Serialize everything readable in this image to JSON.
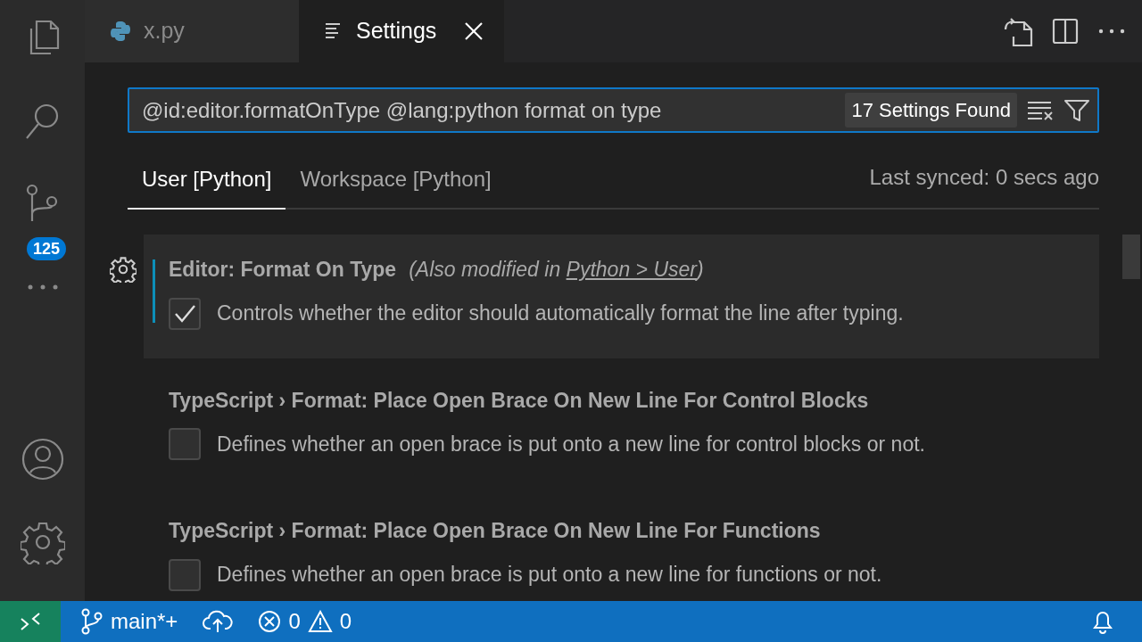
{
  "activity_bar": {
    "source_control_badge": "125"
  },
  "tabs": [
    {
      "label": "x.py",
      "kind": "python",
      "selected": false
    },
    {
      "label": "Settings",
      "kind": "settings",
      "selected": true
    }
  ],
  "search": {
    "value": "@id:editor.formatOnType @lang:python format on type",
    "count": "17 Settings Found"
  },
  "scope_tabs": [
    {
      "label": "User [Python]",
      "selected": true
    },
    {
      "label": "Workspace [Python]",
      "selected": false
    }
  ],
  "sync_status": "Last synced: 0 secs ago",
  "settings": [
    {
      "title": "Editor: **Format On Type**",
      "focused": true,
      "modified": true,
      "note_prefix": "(Also modified in",
      "note_link": "Python > User",
      "note_suffix": ")",
      "checked": true,
      "description": "Controls whether the editor should automatically format the line after typing."
    },
    {
      "title": "TypeScript › Format: **Place Open Brace On New Line For Control Blocks**",
      "focused": false,
      "modified": false,
      "checked": false,
      "description": "Defines whether an open brace is put onto a new line for control blocks or not."
    },
    {
      "title": "TypeScript › Format: **Place Open Brace On New Line For Functions**",
      "focused": false,
      "modified": false,
      "checked": false,
      "description": "Defines whether an open brace is put onto a new line for functions or not."
    }
  ],
  "status_bar": {
    "branch": "main*+",
    "errors": "0",
    "warnings": "0"
  }
}
